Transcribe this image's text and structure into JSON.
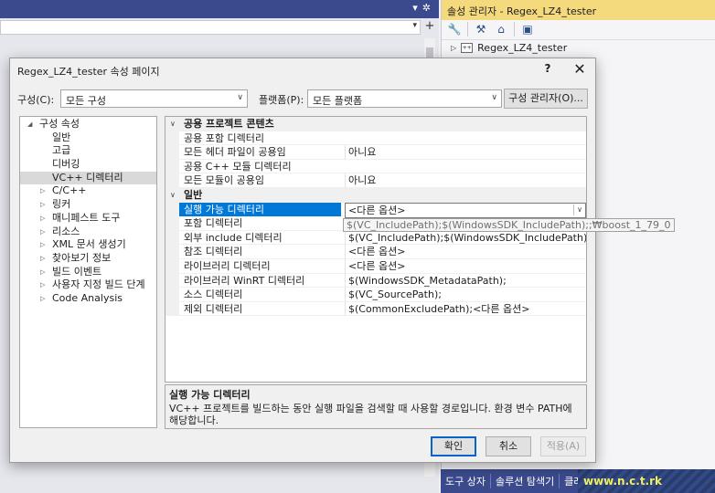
{
  "ide": {
    "explorer_title": "솔성 관리자 - Regex_LZ4_tester",
    "explorer_project": "Regex_LZ4_tester",
    "bottom_tabs": [
      "도구 상자",
      "솔루션 탐색기",
      "클래"
    ],
    "watermark_text": "www.n.c.t.rk"
  },
  "dialog": {
    "title": "Regex_LZ4_tester 속성 페이지",
    "help_label": "?",
    "close_label": "✕",
    "config_label": "구성(C):",
    "config_value": "모든 구성",
    "platform_label": "플랫폼(P):",
    "platform_value": "모든 플랫폼",
    "config_manager_label": "구성 관리자(O)...",
    "ok_label": "확인",
    "cancel_label": "취소",
    "apply_label": "적용(A)"
  },
  "nav_tree": [
    {
      "label": "구성 속성",
      "level": 0,
      "expanded": true
    },
    {
      "label": "일반",
      "level": 1
    },
    {
      "label": "고급",
      "level": 1
    },
    {
      "label": "디버깅",
      "level": 1
    },
    {
      "label": "VC++ 디렉터리",
      "level": 1,
      "selected": true
    },
    {
      "label": "C/C++",
      "level": 1,
      "collapsed": true
    },
    {
      "label": "링커",
      "level": 1,
      "collapsed": true
    },
    {
      "label": "매니페스트 도구",
      "level": 1,
      "collapsed": true
    },
    {
      "label": "리소스",
      "level": 1,
      "collapsed": true
    },
    {
      "label": "XML 문서 생성기",
      "level": 1,
      "collapsed": true
    },
    {
      "label": "찾아보기 정보",
      "level": 1,
      "collapsed": true
    },
    {
      "label": "빌드 이벤트",
      "level": 1,
      "collapsed": true
    },
    {
      "label": "사용자 지정 빌드 단계",
      "level": 1,
      "collapsed": true
    },
    {
      "label": "Code Analysis",
      "level": 1,
      "collapsed": true
    }
  ],
  "grid": {
    "categories": [
      {
        "name": "공용 프로젝트 콘텐츠",
        "props": [
          {
            "name": "공용 포함 디렉터리",
            "value": ""
          },
          {
            "name": "모든 헤더 파일이 공용임",
            "value": "아니요"
          },
          {
            "name": "공용 C++ 모듈 디렉터리",
            "value": ""
          },
          {
            "name": "모든 모듈이 공용임",
            "value": "아니요"
          }
        ]
      },
      {
        "name": "일반",
        "props": [
          {
            "name": "실행 가능 디렉터리",
            "value": "<다른 옵션>",
            "selected": true
          },
          {
            "name": "포함 디렉터리",
            "value": ""
          },
          {
            "name": "외부 include 디렉터리",
            "value": "$(VC_IncludePath);$(WindowsSDK_IncludePath);"
          },
          {
            "name": "참조 디렉터리",
            "value": "<다른 옵션>"
          },
          {
            "name": "라이브러리 디렉터리",
            "value": "<다른 옵션>"
          },
          {
            "name": "라이브러리 WinRT 디렉터리",
            "value": "$(WindowsSDK_MetadataPath);"
          },
          {
            "name": "소스 디렉터리",
            "value": "$(VC_SourcePath);"
          },
          {
            "name": "제외 디렉터리",
            "value": "$(CommonExcludePath);<다른 옵션>"
          }
        ]
      }
    ],
    "tooltip": "$(VC_IncludePath);$(WindowsSDK_IncludePath);;₩boost_1_79_0"
  },
  "description": {
    "title": "실행 가능 디렉터리",
    "text": "VC++ 프로젝트를 빌드하는 동안 실행 파일을 검색할 때 사용할 경로입니다.  환경 변수 PATH에 해당합니다."
  }
}
